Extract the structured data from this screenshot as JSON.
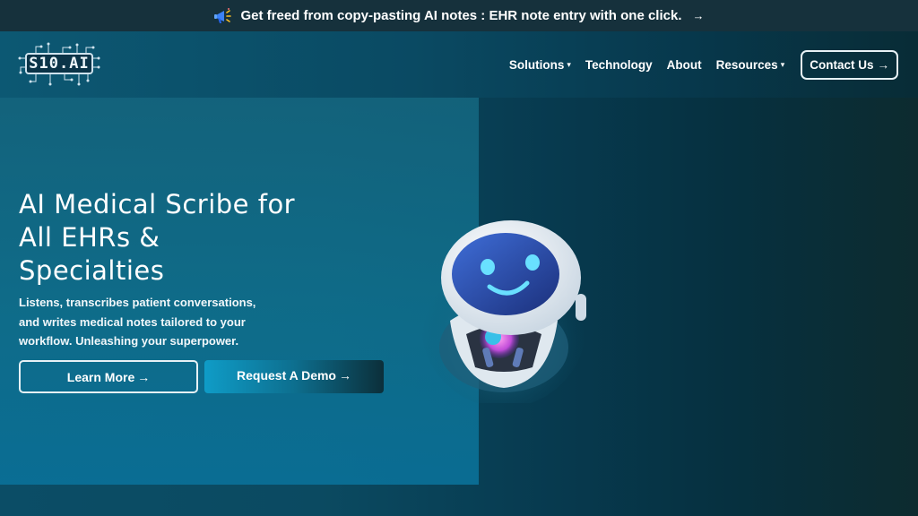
{
  "announcement": {
    "text": "Get freed from copy-pasting AI notes : EHR note entry with one click.",
    "arrow": "→",
    "icon": "megaphone-icon"
  },
  "header": {
    "logo_text": "S10.AI",
    "nav": [
      {
        "label": "Solutions",
        "has_dropdown": true
      },
      {
        "label": "Technology",
        "has_dropdown": false
      },
      {
        "label": "About",
        "has_dropdown": false
      },
      {
        "label": "Resources",
        "has_dropdown": true
      }
    ],
    "contact_label": "Contact Us",
    "contact_arrow": "→",
    "chevron": "⌄"
  },
  "hero": {
    "title_lines": [
      "AI Medical Scribe for",
      "All EHRs &",
      "Specialties"
    ],
    "subtitle_lines": [
      "Listens, transcribes patient conversations,",
      "and writes medical notes tailored to your",
      "workflow. Unleashing your superpower."
    ],
    "learn_more_label": "Learn More",
    "demo_label": "Request A Demo",
    "arrow": "→"
  },
  "colors": {
    "announce_bg": "#16313c",
    "accent": "#0f9cc7",
    "robot_eye": "#69e0ff"
  }
}
